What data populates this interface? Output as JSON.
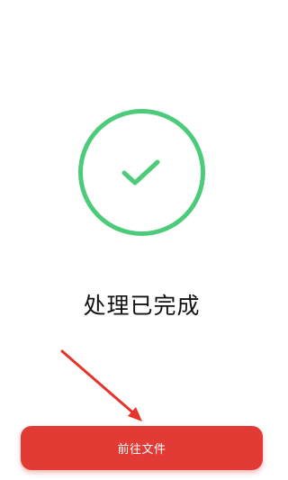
{
  "status": {
    "message": "处理已完成",
    "icon": "check-circle-icon",
    "accent_color": "#4ccb7a"
  },
  "action": {
    "button_label": "前往文件",
    "button_color": "#e23a35"
  },
  "annotation": {
    "icon": "red-arrow-icon",
    "color": "#e7342b"
  }
}
